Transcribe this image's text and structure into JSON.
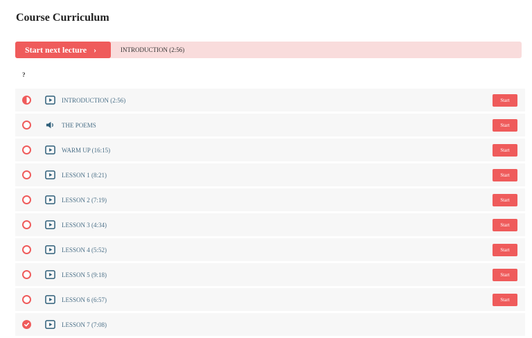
{
  "page": {
    "title": "Course Curriculum",
    "next_button_label": "Start next lecture",
    "next_button_chevron": "›",
    "next_lecture": "INTRODUCTION (2:56)",
    "section_title": "?",
    "accent_color": "#ef5b5b"
  },
  "lectures": [
    {
      "title": "INTRODUCTION (2:56)",
      "status": "in-progress",
      "type": "video-icon",
      "action": "Start"
    },
    {
      "title": "THE POEMS",
      "status": "not-started",
      "type": "audio-icon",
      "action": "Start"
    },
    {
      "title": "WARM UP (16:15)",
      "status": "not-started",
      "type": "video-icon",
      "action": "Start"
    },
    {
      "title": "LESSON 1 (8:21)",
      "status": "not-started",
      "type": "video-icon",
      "action": "Start"
    },
    {
      "title": "LESSON 2 (7:19)",
      "status": "not-started",
      "type": "video-icon",
      "action": "Start"
    },
    {
      "title": "LESSON 3 (4:34)",
      "status": "not-started",
      "type": "video-icon",
      "action": "Start"
    },
    {
      "title": "LESSON 4 (5:52)",
      "status": "not-started",
      "type": "video-icon",
      "action": "Start"
    },
    {
      "title": "LESSON 5 (9:18)",
      "status": "not-started",
      "type": "video-icon",
      "action": "Start"
    },
    {
      "title": "LESSON 6 (6:57)",
      "status": "not-started",
      "type": "video-icon",
      "action": "Start"
    },
    {
      "title": "LESSON 7 (7:08)",
      "status": "completed",
      "type": "video-icon",
      "action": ""
    }
  ]
}
